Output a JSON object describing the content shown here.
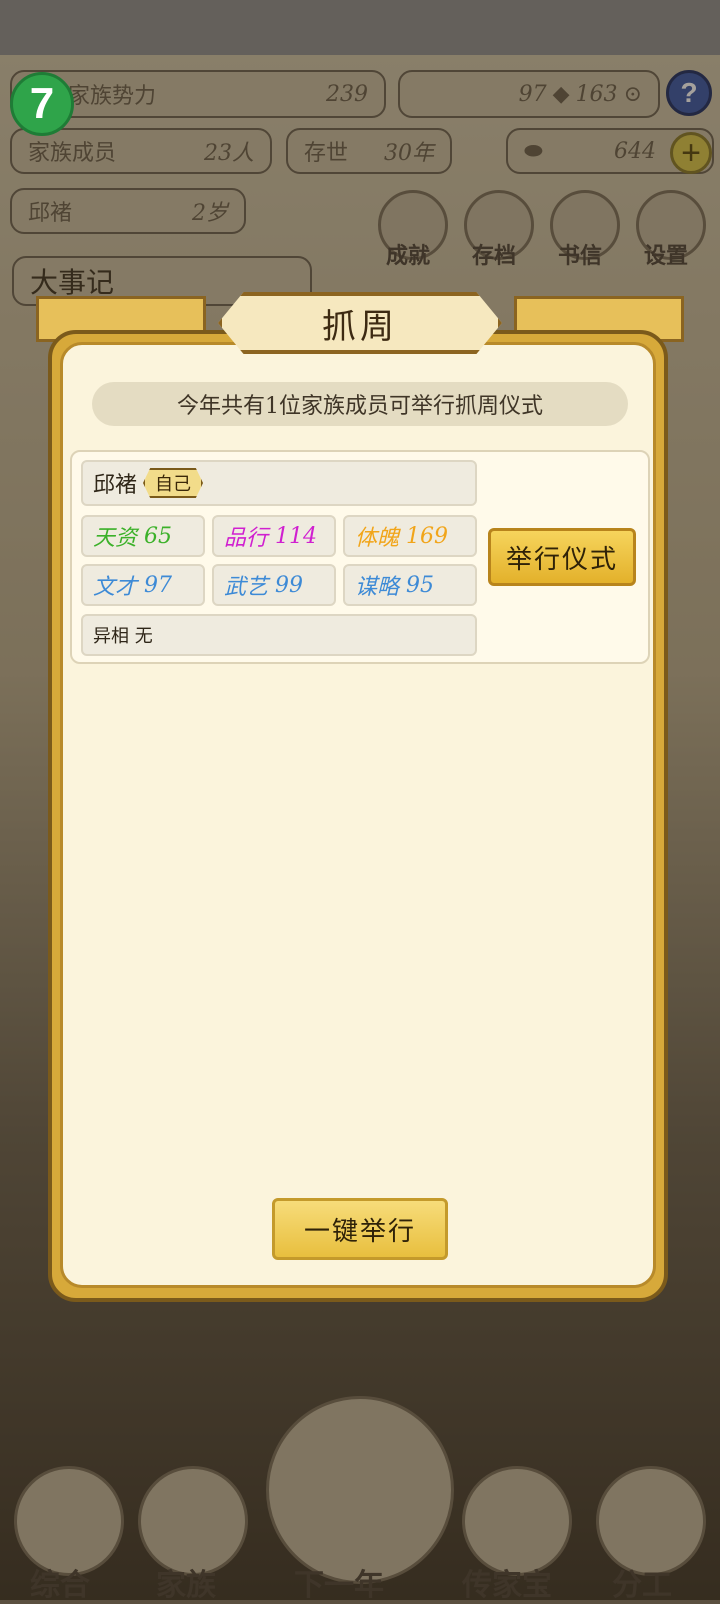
{
  "header": {
    "power_label": "家族势力",
    "power_value": "239",
    "crystals": "97",
    "coins": "163",
    "members_label": "家族成员",
    "members_value": "23人",
    "years_label": "存世",
    "years_value": "30年",
    "gold": "644",
    "self_name": "邱褚",
    "self_age": "2岁",
    "app_badge": "7",
    "help_icon_text": "?"
  },
  "top_buttons": [
    "成就",
    "存档",
    "书信",
    "设置"
  ],
  "events_label": "大事记",
  "bottom_nav": [
    "综合",
    "家族",
    "下一年",
    "传家宝",
    "分工"
  ],
  "dialog": {
    "title": "抓周",
    "notice": "今年共有1位家族成员可举行抓周仪式",
    "member": {
      "name": "邱褚",
      "tag": "自己",
      "stats": [
        {
          "label": "天资",
          "value": "65",
          "color": "#3cb12a"
        },
        {
          "label": "品行",
          "value": "114",
          "color": "#d020d0"
        },
        {
          "label": "体魄",
          "value": "169",
          "color": "#f1a51a"
        },
        {
          "label": "文才",
          "value": "97",
          "color": "#3d8ad6"
        },
        {
          "label": "武艺",
          "value": "99",
          "color": "#3d8ad6"
        },
        {
          "label": "谋略",
          "value": "95",
          "color": "#3d8ad6"
        }
      ],
      "special_label": "异相",
      "special_value": "无"
    },
    "hold_button": "举行仪式",
    "onekey_button": "一键举行"
  }
}
